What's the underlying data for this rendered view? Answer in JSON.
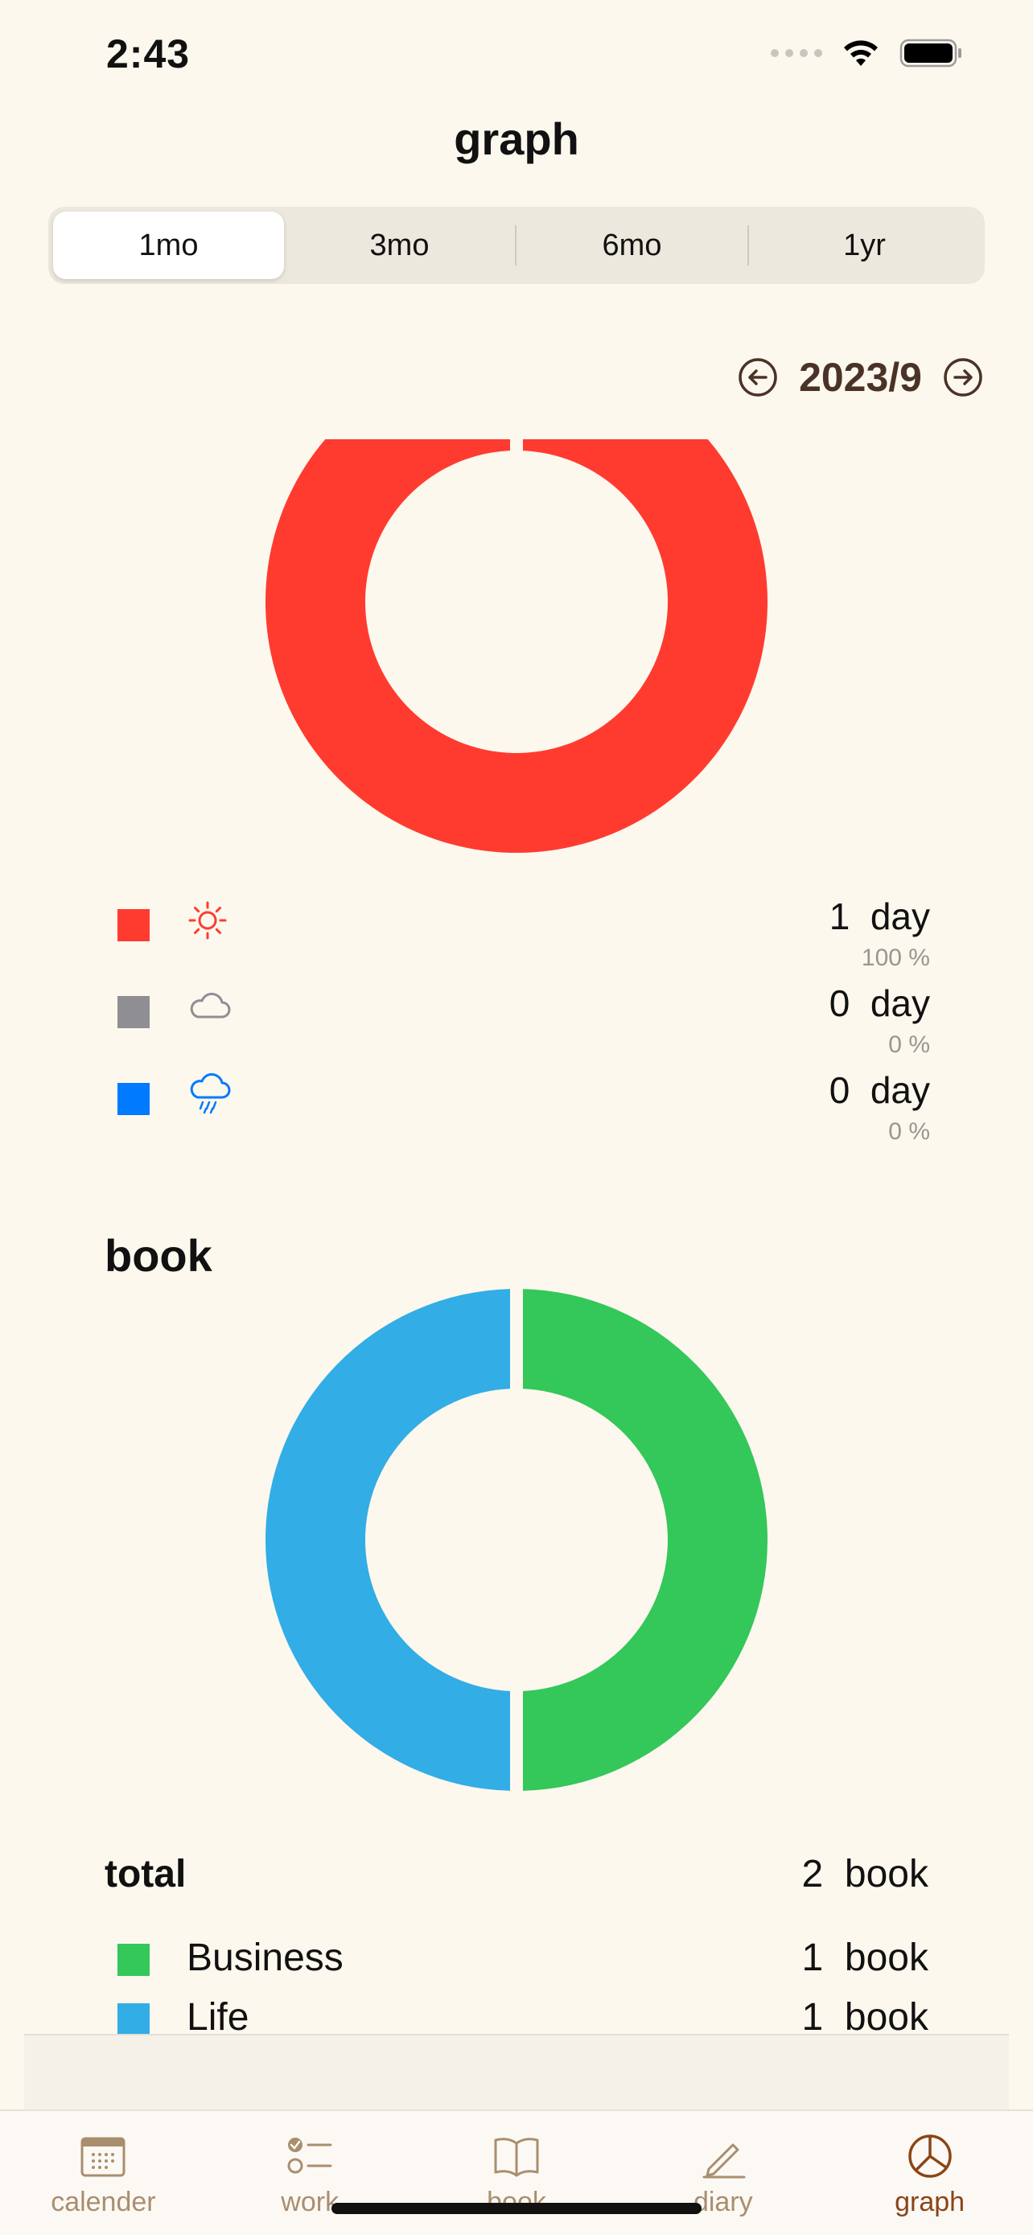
{
  "status_bar": {
    "time": "2:43"
  },
  "nav": {
    "title": "graph"
  },
  "segments": {
    "items": [
      "1mo",
      "3mo",
      "6mo",
      "1yr"
    ],
    "selected": "1mo"
  },
  "period": {
    "label": "2023/9"
  },
  "weather": {
    "rows": [
      {
        "icon": "sun-icon",
        "color": "#FF3B30",
        "value": "1  day",
        "percent": "100 %"
      },
      {
        "icon": "cloud-icon",
        "color": "#8E8E93",
        "value": "0  day",
        "percent": "0 %"
      },
      {
        "icon": "cloud-rain-icon",
        "color": "#007AFF",
        "value": "0  day",
        "percent": "0 %"
      }
    ],
    "chart_data": {
      "type": "pie",
      "categories": [
        "sunny",
        "cloudy",
        "rainy"
      ],
      "values": [
        1,
        0,
        0
      ],
      "colors": [
        "#FF3B30",
        "#8E8E93",
        "#007AFF"
      ]
    }
  },
  "book": {
    "title": "book",
    "total_label": "total",
    "total_value": "2  book",
    "rows": [
      {
        "name": "Business",
        "count": "1  book",
        "color": "#34C759"
      },
      {
        "name": "Life",
        "count": "1  book",
        "color": "#32ADE6"
      }
    ],
    "chart_data": {
      "type": "pie",
      "categories": [
        "Business",
        "Life"
      ],
      "values": [
        1,
        1
      ],
      "colors": [
        "#34C759",
        "#32ADE6"
      ]
    }
  },
  "tabbar": {
    "items": [
      {
        "label": "calender",
        "icon": "calendar-icon"
      },
      {
        "label": "work",
        "icon": "checklist-icon"
      },
      {
        "label": "book",
        "icon": "book-icon"
      },
      {
        "label": "diary",
        "icon": "pencil-icon"
      },
      {
        "label": "graph",
        "icon": "pie-chart-icon"
      }
    ],
    "active": "graph"
  }
}
